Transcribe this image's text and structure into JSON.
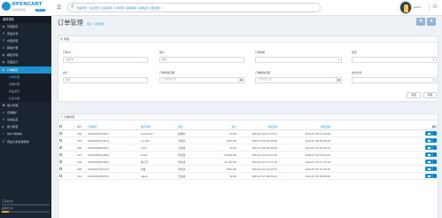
{
  "brand": {
    "name": "OPENCART",
    "sub": "后台管理系统",
    "badge": "3.0.3.2"
  },
  "search": {
    "text": "快速搜索：后台首页 | 商品管理 | 订单管理 | 促销营销 | 系统设置 | 报表统计"
  },
  "user": {
    "name": "admin"
  },
  "colors": {
    "accent": "#1e91cf",
    "sidebar_bg": "#1b2431",
    "page_bg": "#eef1f5",
    "header_btn": "#8fb4d8"
  },
  "sidebar": {
    "header": "菜单导航",
    "items": [
      {
        "label": "管理首页",
        "icon": "dashboard-icon"
      },
      {
        "label": "商品目录",
        "icon": "tags-icon"
      },
      {
        "label": "内容管理",
        "icon": "file-icon"
      },
      {
        "label": "模组扩展",
        "icon": "puzzle-icon"
      },
      {
        "label": "模板管理",
        "icon": "monitor-icon"
      },
      {
        "label": "页面设计",
        "icon": "layout-icon"
      },
      {
        "label": "订单销售",
        "icon": "cart-icon",
        "active": true
      },
      {
        "label": "客户管理",
        "icon": "user-icon"
      },
      {
        "label": "营销推广",
        "icon": "share-icon"
      },
      {
        "label": "系统设置",
        "icon": "gear-icon"
      },
      {
        "label": "统计报表",
        "icon": "chart-icon"
      },
      {
        "label": "Ajax 购物车",
        "icon": "bolt-icon"
      },
      {
        "label": "商品分类批量编辑",
        "icon": "list-icon"
      }
    ],
    "subitems": [
      "订单管理",
      "定期管理",
      "商品退货",
      "礼品卡券"
    ],
    "progress": [
      {
        "label": "已完成订单",
        "value": 0.0
      },
      {
        "label": "处理中订单",
        "value": 0.15
      }
    ]
  },
  "page": {
    "title": "订单管理",
    "breadcrumb": [
      "首页",
      "订单管理"
    ]
  },
  "filter": {
    "heading": "筛选",
    "order_id": {
      "label": "订单 ID",
      "placeholder": "订单 ID"
    },
    "customer": {
      "label": "客户",
      "placeholder": "客户"
    },
    "order_status": {
      "label": "订单状态",
      "value": ""
    },
    "total": {
      "label": "总计",
      "placeholder": "总计"
    },
    "date_added": {
      "label": "订单添加日期",
      "placeholder": "订单添加日期"
    },
    "date_modified": {
      "label": "订单修改日期",
      "placeholder": "订单修改日期"
    },
    "store": {
      "label": "商店",
      "value": ""
    },
    "payment": {
      "label": "支付方式",
      "value": ""
    },
    "total_prefix": "(RMB)",
    "filter_button": "筛选",
    "reset_button": "重置"
  },
  "orders": {
    "heading": "订单列表",
    "columns": [
      "",
      "编号",
      "订单编号",
      "客户名称",
      "状态",
      "总计",
      "添加日期",
      "修改日期",
      "",
      "操作"
    ],
    "rows": [
      {
        "no": "200",
        "order_no": "20190326214227",
        "customer": "avdodiokx",
        "status": "处理中",
        "total": "¥4.00",
        "added": "2019-07-09 11:23:57",
        "modified": "2019-07-09 11:28:08"
      },
      {
        "no": "199",
        "order_no": "20190325214114",
        "customer": "Ivy Zuo",
        "status": "待付款",
        "total": "¥700.00",
        "added": "2019-07-08 09:58:18",
        "modified": "2019-07-08 09:58:18"
      },
      {
        "no": "198",
        "order_no": "20190309064231",
        "customer": "1121",
        "status": "已完成",
        "total": "¥0.00",
        "added": "2019-07-05 09:40:09",
        "modified": "2019-07-05 09:40:11"
      },
      {
        "no": "197",
        "order_no": "20190308114954",
        "customer": "kudai",
        "status": "待付款",
        "total": "¥5,050.00",
        "added": "2019-07-04 10:02:54",
        "modified": "2019-07-04 10:02:54"
      },
      {
        "no": "196",
        "order_no": "20190308103503",
        "customer": "霍小莹",
        "status": "待付款",
        "total": "¥1,300.00",
        "added": "2019-07-03 17:31:33",
        "modified": "2019-07-03 17:31:33"
      },
      {
        "no": "195",
        "order_no": "20190307105124",
        "customer": "孙夏",
        "status": "待付款",
        "total": "¥500.00",
        "added": "2019-07-02 10:25:52",
        "modified": "2019-07-02 10:25:52"
      },
      {
        "no": "194",
        "order_no": "20190305084742",
        "customer": "qiqua",
        "status": "已完成",
        "total": "¥0.00",
        "added": "2019-07-01 08:48:01",
        "modified": "2019-07-01 08:48:05"
      }
    ]
  }
}
